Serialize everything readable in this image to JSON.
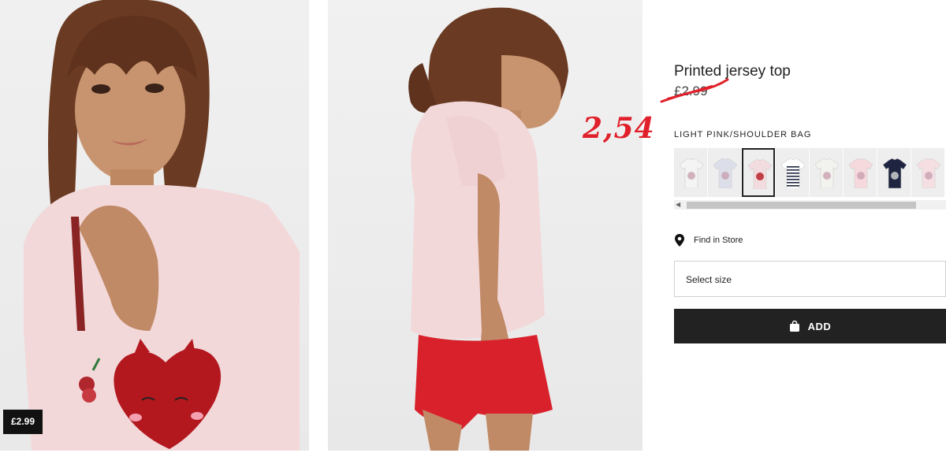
{
  "gallery": {
    "photo_price_tag": "£2.99"
  },
  "product": {
    "title": "Printed jersey top",
    "old_price": "£2.99",
    "handwritten_price": "2,54",
    "color_name": "LIGHT PINK/SHOULDER BAG",
    "swatches": [
      {
        "color": "#f4f4f4",
        "print": "unicorn"
      },
      {
        "color": "#dcdfea",
        "print": "cat"
      },
      {
        "color": "#f3dcdf",
        "print": "shoulder-bag",
        "selected": true
      },
      {
        "color": "#ffffff",
        "print": "stripes"
      },
      {
        "color": "#f2f2ee",
        "print": "dots"
      },
      {
        "color": "#f6d9dc",
        "print": "flowers"
      },
      {
        "color": "#1f2540",
        "print": "graphic"
      },
      {
        "color": "#f5dfe3",
        "print": "bunny"
      }
    ]
  },
  "store": {
    "find_in_store": "Find in Store"
  },
  "size": {
    "placeholder": "Select size"
  },
  "cart": {
    "add_label": "ADD"
  },
  "colors": {
    "accent_red": "#e0202a",
    "button_dark": "#222222"
  }
}
